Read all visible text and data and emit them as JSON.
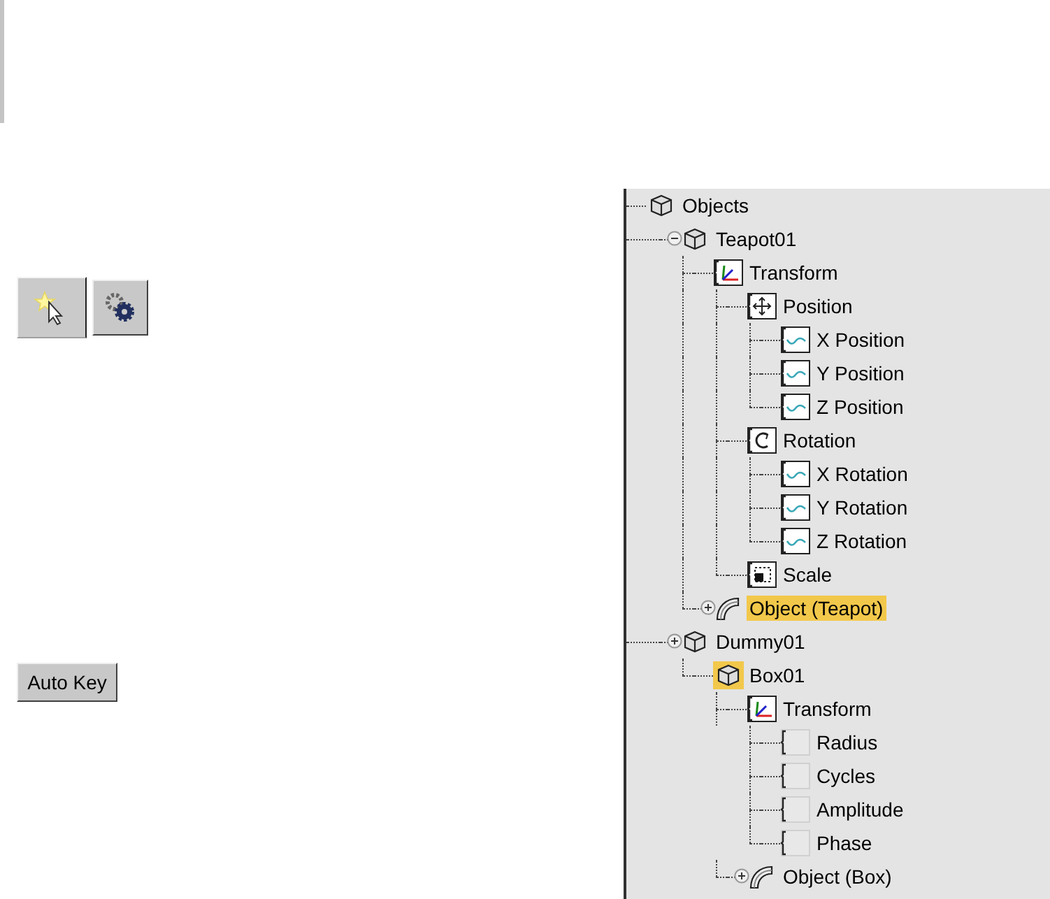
{
  "toolbar": {
    "buttons": [
      {
        "kind": "select-star",
        "pressed": true
      },
      {
        "kind": "gears",
        "pressed": false
      }
    ]
  },
  "auto_key_button": {
    "label": "Auto Key"
  },
  "tree": {
    "items": [
      {
        "label": "Objects",
        "kind": "object",
        "selected": false,
        "children": [
          {
            "label": "Teapot01",
            "kind": "object",
            "selected": false,
            "expanded": true,
            "children": [
              {
                "label": "Transform",
                "kind": "transform",
                "selected": false,
                "children": [
                  {
                    "label": "Position",
                    "kind": "position",
                    "selected": false,
                    "children": [
                      {
                        "label": "X Position",
                        "kind": "curve",
                        "selected": false
                      },
                      {
                        "label": "Y Position",
                        "kind": "curve",
                        "selected": false
                      },
                      {
                        "label": "Z Position",
                        "kind": "curve",
                        "selected": false
                      }
                    ]
                  },
                  {
                    "label": "Rotation",
                    "kind": "rotation",
                    "selected": false,
                    "children": [
                      {
                        "label": "X Rotation",
                        "kind": "curve",
                        "selected": false
                      },
                      {
                        "label": "Y Rotation",
                        "kind": "curve",
                        "selected": false
                      },
                      {
                        "label": "Z Rotation",
                        "kind": "curve",
                        "selected": false
                      }
                    ]
                  },
                  {
                    "label": "Scale",
                    "kind": "scale",
                    "selected": false
                  }
                ]
              },
              {
                "label": "Object (Teapot)",
                "kind": "modifier",
                "selected": true,
                "expanded": false
              }
            ]
          },
          {
            "label": "Dummy01",
            "kind": "object",
            "selected": false,
            "expanded": false,
            "children": [
              {
                "label": "Box01",
                "kind": "object",
                "selected": false,
                "icon_selected": true,
                "children": [
                  {
                    "label": "Transform",
                    "kind": "transform",
                    "selected": false,
                    "children": [
                      {
                        "label": "Radius",
                        "kind": "param",
                        "selected": false
                      },
                      {
                        "label": "Cycles",
                        "kind": "param",
                        "selected": false
                      },
                      {
                        "label": "Amplitude",
                        "kind": "param",
                        "selected": false
                      },
                      {
                        "label": "Phase",
                        "kind": "param",
                        "selected": false
                      }
                    ]
                  },
                  {
                    "label": "Object (Box)",
                    "kind": "modifier",
                    "selected": false,
                    "expanded": false
                  }
                ]
              }
            ]
          }
        ]
      }
    ]
  }
}
